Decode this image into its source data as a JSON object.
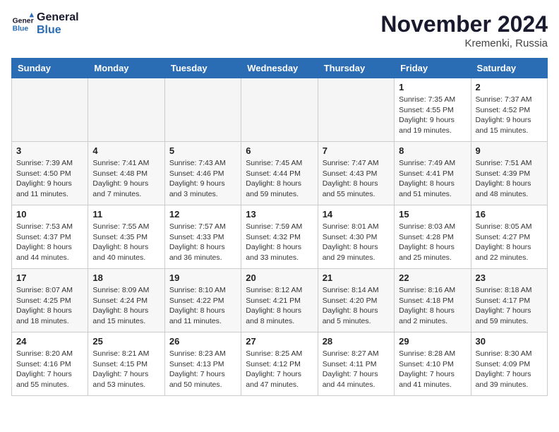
{
  "header": {
    "logo_line1": "General",
    "logo_line2": "Blue",
    "month_title": "November 2024",
    "location": "Kremenki, Russia"
  },
  "days_of_week": [
    "Sunday",
    "Monday",
    "Tuesday",
    "Wednesday",
    "Thursday",
    "Friday",
    "Saturday"
  ],
  "weeks": [
    {
      "shade": "white",
      "days": [
        {
          "num": "",
          "empty": true
        },
        {
          "num": "",
          "empty": true
        },
        {
          "num": "",
          "empty": true
        },
        {
          "num": "",
          "empty": true
        },
        {
          "num": "",
          "empty": true
        },
        {
          "num": "1",
          "sunrise": "Sunrise: 7:35 AM",
          "sunset": "Sunset: 4:55 PM",
          "daylight": "Daylight: 9 hours and 19 minutes."
        },
        {
          "num": "2",
          "sunrise": "Sunrise: 7:37 AM",
          "sunset": "Sunset: 4:52 PM",
          "daylight": "Daylight: 9 hours and 15 minutes."
        }
      ]
    },
    {
      "shade": "gray",
      "days": [
        {
          "num": "3",
          "sunrise": "Sunrise: 7:39 AM",
          "sunset": "Sunset: 4:50 PM",
          "daylight": "Daylight: 9 hours and 11 minutes."
        },
        {
          "num": "4",
          "sunrise": "Sunrise: 7:41 AM",
          "sunset": "Sunset: 4:48 PM",
          "daylight": "Daylight: 9 hours and 7 minutes."
        },
        {
          "num": "5",
          "sunrise": "Sunrise: 7:43 AM",
          "sunset": "Sunset: 4:46 PM",
          "daylight": "Daylight: 9 hours and 3 minutes."
        },
        {
          "num": "6",
          "sunrise": "Sunrise: 7:45 AM",
          "sunset": "Sunset: 4:44 PM",
          "daylight": "Daylight: 8 hours and 59 minutes."
        },
        {
          "num": "7",
          "sunrise": "Sunrise: 7:47 AM",
          "sunset": "Sunset: 4:43 PM",
          "daylight": "Daylight: 8 hours and 55 minutes."
        },
        {
          "num": "8",
          "sunrise": "Sunrise: 7:49 AM",
          "sunset": "Sunset: 4:41 PM",
          "daylight": "Daylight: 8 hours and 51 minutes."
        },
        {
          "num": "9",
          "sunrise": "Sunrise: 7:51 AM",
          "sunset": "Sunset: 4:39 PM",
          "daylight": "Daylight: 8 hours and 48 minutes."
        }
      ]
    },
    {
      "shade": "white",
      "days": [
        {
          "num": "10",
          "sunrise": "Sunrise: 7:53 AM",
          "sunset": "Sunset: 4:37 PM",
          "daylight": "Daylight: 8 hours and 44 minutes."
        },
        {
          "num": "11",
          "sunrise": "Sunrise: 7:55 AM",
          "sunset": "Sunset: 4:35 PM",
          "daylight": "Daylight: 8 hours and 40 minutes."
        },
        {
          "num": "12",
          "sunrise": "Sunrise: 7:57 AM",
          "sunset": "Sunset: 4:33 PM",
          "daylight": "Daylight: 8 hours and 36 minutes."
        },
        {
          "num": "13",
          "sunrise": "Sunrise: 7:59 AM",
          "sunset": "Sunset: 4:32 PM",
          "daylight": "Daylight: 8 hours and 33 minutes."
        },
        {
          "num": "14",
          "sunrise": "Sunrise: 8:01 AM",
          "sunset": "Sunset: 4:30 PM",
          "daylight": "Daylight: 8 hours and 29 minutes."
        },
        {
          "num": "15",
          "sunrise": "Sunrise: 8:03 AM",
          "sunset": "Sunset: 4:28 PM",
          "daylight": "Daylight: 8 hours and 25 minutes."
        },
        {
          "num": "16",
          "sunrise": "Sunrise: 8:05 AM",
          "sunset": "Sunset: 4:27 PM",
          "daylight": "Daylight: 8 hours and 22 minutes."
        }
      ]
    },
    {
      "shade": "gray",
      "days": [
        {
          "num": "17",
          "sunrise": "Sunrise: 8:07 AM",
          "sunset": "Sunset: 4:25 PM",
          "daylight": "Daylight: 8 hours and 18 minutes."
        },
        {
          "num": "18",
          "sunrise": "Sunrise: 8:09 AM",
          "sunset": "Sunset: 4:24 PM",
          "daylight": "Daylight: 8 hours and 15 minutes."
        },
        {
          "num": "19",
          "sunrise": "Sunrise: 8:10 AM",
          "sunset": "Sunset: 4:22 PM",
          "daylight": "Daylight: 8 hours and 11 minutes."
        },
        {
          "num": "20",
          "sunrise": "Sunrise: 8:12 AM",
          "sunset": "Sunset: 4:21 PM",
          "daylight": "Daylight: 8 hours and 8 minutes."
        },
        {
          "num": "21",
          "sunrise": "Sunrise: 8:14 AM",
          "sunset": "Sunset: 4:20 PM",
          "daylight": "Daylight: 8 hours and 5 minutes."
        },
        {
          "num": "22",
          "sunrise": "Sunrise: 8:16 AM",
          "sunset": "Sunset: 4:18 PM",
          "daylight": "Daylight: 8 hours and 2 minutes."
        },
        {
          "num": "23",
          "sunrise": "Sunrise: 8:18 AM",
          "sunset": "Sunset: 4:17 PM",
          "daylight": "Daylight: 7 hours and 59 minutes."
        }
      ]
    },
    {
      "shade": "white",
      "days": [
        {
          "num": "24",
          "sunrise": "Sunrise: 8:20 AM",
          "sunset": "Sunset: 4:16 PM",
          "daylight": "Daylight: 7 hours and 55 minutes."
        },
        {
          "num": "25",
          "sunrise": "Sunrise: 8:21 AM",
          "sunset": "Sunset: 4:15 PM",
          "daylight": "Daylight: 7 hours and 53 minutes."
        },
        {
          "num": "26",
          "sunrise": "Sunrise: 8:23 AM",
          "sunset": "Sunset: 4:13 PM",
          "daylight": "Daylight: 7 hours and 50 minutes."
        },
        {
          "num": "27",
          "sunrise": "Sunrise: 8:25 AM",
          "sunset": "Sunset: 4:12 PM",
          "daylight": "Daylight: 7 hours and 47 minutes."
        },
        {
          "num": "28",
          "sunrise": "Sunrise: 8:27 AM",
          "sunset": "Sunset: 4:11 PM",
          "daylight": "Daylight: 7 hours and 44 minutes."
        },
        {
          "num": "29",
          "sunrise": "Sunrise: 8:28 AM",
          "sunset": "Sunset: 4:10 PM",
          "daylight": "Daylight: 7 hours and 41 minutes."
        },
        {
          "num": "30",
          "sunrise": "Sunrise: 8:30 AM",
          "sunset": "Sunset: 4:09 PM",
          "daylight": "Daylight: 7 hours and 39 minutes."
        }
      ]
    }
  ]
}
